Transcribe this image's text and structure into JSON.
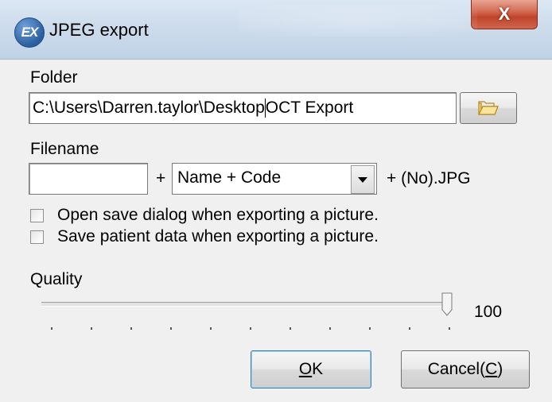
{
  "window": {
    "title": "JPEG export",
    "app_icon_text": "EX",
    "close_glyph": "X"
  },
  "folder": {
    "label": "Folder",
    "path_before_caret": "C:\\Users\\Darren.taylor\\Desktop",
    "path_after_caret": "OCT Export",
    "browse_icon": "folder-open-icon"
  },
  "filename": {
    "label": "Filename",
    "prefix_value": "",
    "plus": "+",
    "pattern_selected": "Name + Code",
    "suffix": "+ (No).JPG"
  },
  "options": {
    "open_save_dialog": {
      "label": "Open save dialog when exporting a picture.",
      "checked": false
    },
    "save_patient_data": {
      "label": "Save patient data when exporting a picture.",
      "checked": false
    }
  },
  "quality": {
    "label": "Quality",
    "value": "100",
    "fraction": 1.0
  },
  "buttons": {
    "ok_label": "OK",
    "ok_mnemonic": "O",
    "cancel_label": "Cancel(",
    "cancel_mnemonic": "C",
    "cancel_tail": ")"
  },
  "colors": {
    "close_button": "#c9503a",
    "title_bar": "#cddcec",
    "dialog_bg": "#f0f0f0",
    "default_button_border": "#3c7fb1"
  }
}
